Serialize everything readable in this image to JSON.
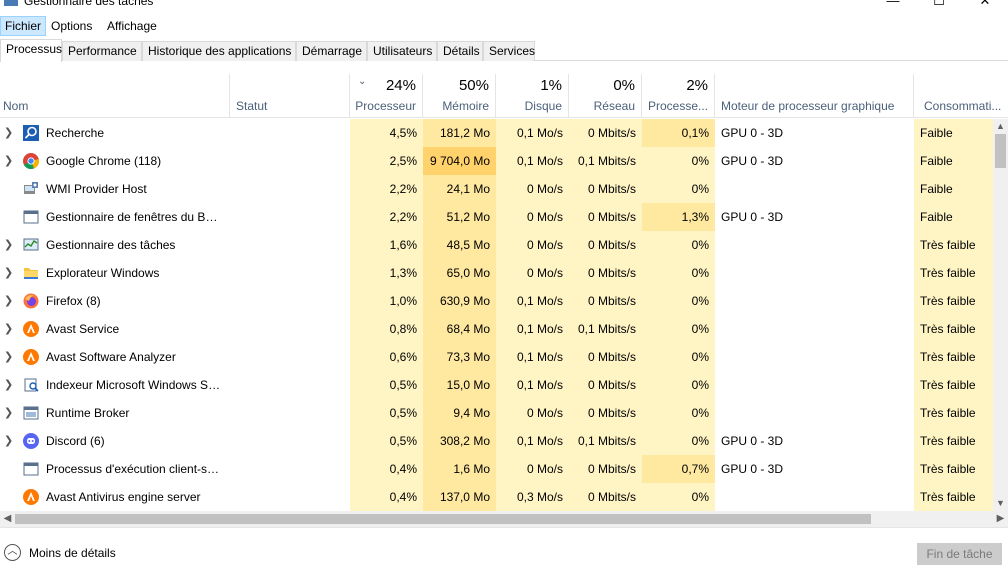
{
  "window": {
    "title": "Gestionnaire des tâches",
    "controls": [
      "—",
      "☐",
      "✕"
    ]
  },
  "menu": [
    "Fichier",
    "Options",
    "Affichage"
  ],
  "tabs": [
    "Processus",
    "Performance",
    "Historique des applications",
    "Démarrage",
    "Utilisateurs",
    "Détails",
    "Services"
  ],
  "columns": {
    "name": "Nom",
    "status": "Statut",
    "cpu": {
      "pct": "24%",
      "label": "Processeur"
    },
    "memory": {
      "pct": "50%",
      "label": "Mémoire"
    },
    "disk": {
      "pct": "1%",
      "label": "Disque"
    },
    "network": {
      "pct": "0%",
      "label": "Réseau"
    },
    "gpu": {
      "pct": "2%",
      "label": "Processe..."
    },
    "gpu_engine": "Moteur de processeur graphique",
    "power": "Consommati..."
  },
  "rows": [
    {
      "name": "Recherche",
      "icon": "search-icon",
      "expand": true,
      "cpu": "4,5%",
      "mem": "181,2 Mo",
      "disk": "0,1 Mo/s",
      "net": "0 Mbits/s",
      "gpu": "0,1%",
      "engine": "GPU 0 - 3D",
      "power": "Faible"
    },
    {
      "name": "Google Chrome (118)",
      "icon": "chrome-icon",
      "expand": true,
      "cpu": "2,5%",
      "mem": "9 704,0 Mo",
      "disk": "0,1 Mo/s",
      "net": "0,1 Mbits/s",
      "gpu": "0%",
      "engine": "GPU 0 - 3D",
      "power": "Faible"
    },
    {
      "name": "WMI Provider Host",
      "icon": "wmi-icon",
      "expand": false,
      "cpu": "2,2%",
      "mem": "24,1 Mo",
      "disk": "0 Mo/s",
      "net": "0 Mbits/s",
      "gpu": "0%",
      "engine": "",
      "power": "Faible"
    },
    {
      "name": "Gestionnaire de fenêtres du Bur...",
      "icon": "window-manager-icon",
      "expand": false,
      "cpu": "2,2%",
      "mem": "51,2 Mo",
      "disk": "0 Mo/s",
      "net": "0 Mbits/s",
      "gpu": "1,3%",
      "engine": "GPU 0 - 3D",
      "power": "Faible"
    },
    {
      "name": "Gestionnaire des tâches",
      "icon": "task-manager-icon",
      "expand": true,
      "cpu": "1,6%",
      "mem": "48,5 Mo",
      "disk": "0 Mo/s",
      "net": "0 Mbits/s",
      "gpu": "0%",
      "engine": "",
      "power": "Très faible"
    },
    {
      "name": "Explorateur Windows",
      "icon": "folder-icon",
      "expand": true,
      "cpu": "1,3%",
      "mem": "65,0 Mo",
      "disk": "0 Mo/s",
      "net": "0 Mbits/s",
      "gpu": "0%",
      "engine": "",
      "power": "Très faible"
    },
    {
      "name": "Firefox (8)",
      "icon": "firefox-icon",
      "expand": true,
      "cpu": "1,0%",
      "mem": "630,9 Mo",
      "disk": "0,1 Mo/s",
      "net": "0 Mbits/s",
      "gpu": "0%",
      "engine": "",
      "power": "Très faible"
    },
    {
      "name": "Avast Service",
      "icon": "avast-icon",
      "expand": true,
      "cpu": "0,8%",
      "mem": "68,4 Mo",
      "disk": "0,1 Mo/s",
      "net": "0,1 Mbits/s",
      "gpu": "0%",
      "engine": "",
      "power": "Très faible"
    },
    {
      "name": "Avast Software Analyzer",
      "icon": "avast-icon",
      "expand": true,
      "cpu": "0,6%",
      "mem": "73,3 Mo",
      "disk": "0,1 Mo/s",
      "net": "0 Mbits/s",
      "gpu": "0%",
      "engine": "",
      "power": "Très faible"
    },
    {
      "name": "Indexeur Microsoft Windows Se...",
      "icon": "indexer-icon",
      "expand": true,
      "cpu": "0,5%",
      "mem": "15,0 Mo",
      "disk": "0,1 Mo/s",
      "net": "0 Mbits/s",
      "gpu": "0%",
      "engine": "",
      "power": "Très faible"
    },
    {
      "name": "Runtime Broker",
      "icon": "runtime-broker-icon",
      "expand": true,
      "cpu": "0,5%",
      "mem": "9,4 Mo",
      "disk": "0 Mo/s",
      "net": "0 Mbits/s",
      "gpu": "0%",
      "engine": "",
      "power": "Très faible"
    },
    {
      "name": "Discord (6)",
      "icon": "discord-icon",
      "expand": true,
      "cpu": "0,5%",
      "mem": "308,2 Mo",
      "disk": "0,1 Mo/s",
      "net": "0,1 Mbits/s",
      "gpu": "0%",
      "engine": "GPU 0 - 3D",
      "power": "Très faible"
    },
    {
      "name": "Processus d'exécution client-ser...",
      "icon": "csrss-icon",
      "expand": false,
      "cpu": "0,4%",
      "mem": "1,6 Mo",
      "disk": "0 Mo/s",
      "net": "0 Mbits/s",
      "gpu": "0,7%",
      "engine": "GPU 0 - 3D",
      "power": "Très faible"
    },
    {
      "name": "Avast Antivirus engine server",
      "icon": "avast-icon",
      "expand": false,
      "cpu": "0,4%",
      "mem": "137,0 Mo",
      "disk": "0,3 Mo/s",
      "net": "0 Mbits/s",
      "gpu": "0%",
      "engine": "",
      "power": "Très faible"
    }
  ],
  "footer": {
    "less_details": "Moins de détails",
    "end_task": "Fin de tâche"
  }
}
